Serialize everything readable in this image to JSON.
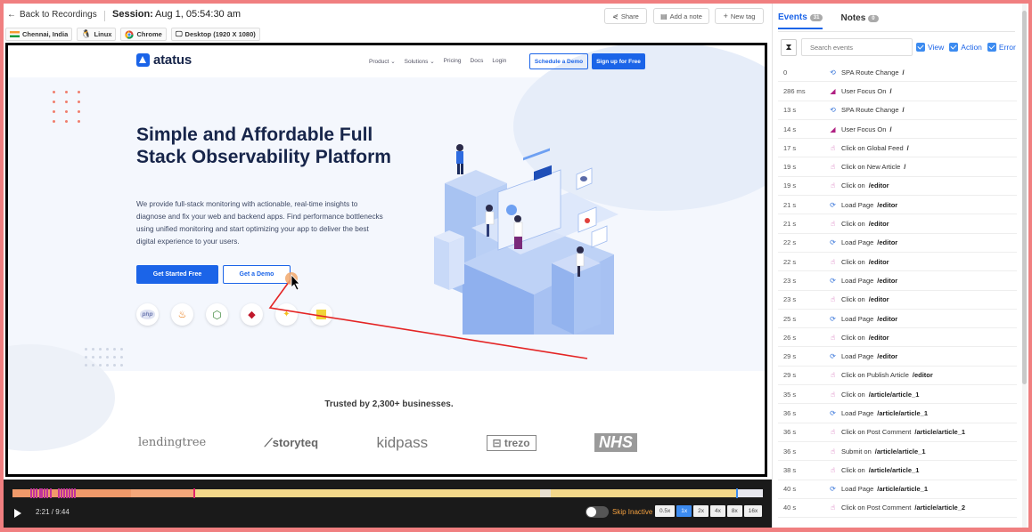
{
  "topbar": {
    "back_label": "Back to Recordings",
    "session_label": "Session:",
    "session_value": "Aug 1, 05:54:30 am",
    "share_label": "Share",
    "note_label": "Add a note",
    "tag_label": "New tag"
  },
  "chips": {
    "location": "Chennai, India",
    "os": "Linux",
    "browser": "Chrome",
    "device": "Desktop (1920 X 1080)"
  },
  "site": {
    "logo": "atatus",
    "nav": [
      "Product ⌄",
      "Solutions ⌄",
      "Pricing",
      "Docs",
      "Login"
    ],
    "schedule_btn": "Schedule a Demo",
    "signup_btn": "Sign up for Free",
    "hero_title": "Simple and Affordable Full Stack Observability Platform",
    "hero_desc": "We provide full-stack monitoring with actionable, real-time insights to diagnose and fix your web and backend apps. Find performance bottlenecks using unified monitoring and start optimizing your app to deliver the best digital experience to your users.",
    "btn_start": "Get Started Free",
    "btn_demo": "Get a Demo",
    "techs": [
      "php",
      "java",
      "node",
      "ruby",
      "python",
      "js"
    ],
    "trusted": "Trusted by 2,300+ businesses.",
    "brands": {
      "lending": "lendingtree",
      "story": "storyteq",
      "kid": "kidpass",
      "trezo": "trezo",
      "nhs": "NHS"
    }
  },
  "player": {
    "time": "2:21 / 9:44",
    "progress": 0.2415,
    "skip_label": "Skip Inactive",
    "speeds": [
      "0.5x",
      "1x",
      "2x",
      "4x",
      "8x",
      "16x"
    ],
    "active_speed": "1x"
  },
  "panel": {
    "tab_events": "Events",
    "tab_events_count": "31",
    "tab_notes": "Notes",
    "tab_notes_count": "0",
    "search_placeholder": "Search events",
    "filter_view": "View",
    "filter_action": "Action",
    "filter_error": "Error",
    "events": [
      {
        "time": "0",
        "type": "route",
        "label": "SPA Route Change",
        "path": "/"
      },
      {
        "time": "286 ms",
        "type": "focus",
        "label": "User Focus On",
        "path": "/"
      },
      {
        "time": "13 s",
        "type": "route",
        "label": "SPA Route Change",
        "path": "/"
      },
      {
        "time": "14 s",
        "type": "focus",
        "label": "User Focus On",
        "path": "/"
      },
      {
        "time": "17 s",
        "type": "click",
        "label": "Click on Global Feed",
        "path": "/"
      },
      {
        "time": "19 s",
        "type": "click",
        "label": "Click on New Article",
        "path": "/"
      },
      {
        "time": "19 s",
        "type": "click",
        "label": "Click on",
        "path": "/editor"
      },
      {
        "time": "21 s",
        "type": "load",
        "label": "Load Page",
        "path": "/editor"
      },
      {
        "time": "21 s",
        "type": "click",
        "label": "Click on",
        "path": "/editor"
      },
      {
        "time": "22 s",
        "type": "load",
        "label": "Load Page",
        "path": "/editor"
      },
      {
        "time": "22 s",
        "type": "click",
        "label": "Click on",
        "path": "/editor"
      },
      {
        "time": "23 s",
        "type": "load",
        "label": "Load Page",
        "path": "/editor"
      },
      {
        "time": "23 s",
        "type": "click",
        "label": "Click on",
        "path": "/editor"
      },
      {
        "time": "25 s",
        "type": "load",
        "label": "Load Page",
        "path": "/editor"
      },
      {
        "time": "26 s",
        "type": "click",
        "label": "Click on",
        "path": "/editor"
      },
      {
        "time": "29 s",
        "type": "load",
        "label": "Load Page",
        "path": "/editor"
      },
      {
        "time": "29 s",
        "type": "click",
        "label": "Click on Publish Article",
        "path": "/editor"
      },
      {
        "time": "35 s",
        "type": "click",
        "label": "Click on",
        "path": "/article/article_1"
      },
      {
        "time": "36 s",
        "type": "load",
        "label": "Load Page",
        "path": "/article/article_1"
      },
      {
        "time": "36 s",
        "type": "click",
        "label": "Click on Post Comment",
        "path": "/article/article_1"
      },
      {
        "time": "36 s",
        "type": "click",
        "label": "Submit on",
        "path": "/article/article_1"
      },
      {
        "time": "38 s",
        "type": "click",
        "label": "Click on",
        "path": "/article/article_1"
      },
      {
        "time": "40 s",
        "type": "load",
        "label": "Load Page",
        "path": "/article/article_1"
      },
      {
        "time": "40 s",
        "type": "click",
        "label": "Click on Post Comment",
        "path": "/article/article_2"
      }
    ]
  },
  "colors": {
    "accent": "#1b64e8",
    "route_icon": "#2f6fd8",
    "focus_icon": "#b02082",
    "click_icon": "#c63aa0",
    "load_icon": "#2f6fd8"
  }
}
